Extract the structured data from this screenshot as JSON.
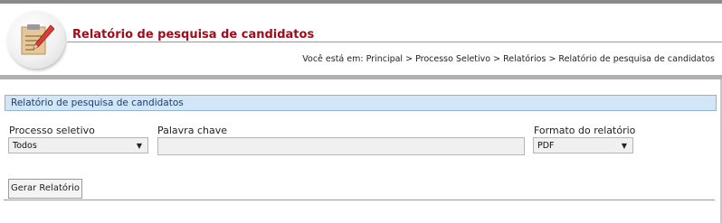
{
  "header": {
    "title": "Relatório de pesquisa de candidatos",
    "breadcrumb": "Você está em: Principal > Processo Seletivo > Relatórios > Relatório de pesquisa de candidatos"
  },
  "section": {
    "title": "Relatório de pesquisa de candidatos"
  },
  "form": {
    "processo": {
      "label": "Processo seletivo",
      "value": "Todos"
    },
    "palavra": {
      "label": "Palavra chave",
      "value": ""
    },
    "formato": {
      "label": "Formato do relatório",
      "value": "PDF"
    }
  },
  "actions": {
    "generate_label": "Gerar Relatório"
  },
  "colors": {
    "title_red": "#a30b1a",
    "section_bg": "#d3e6f7",
    "section_border": "#8fb5d8"
  },
  "icons": {
    "logo": "report-pencil-icon",
    "dropdown": "dropdown-arrow-icon"
  }
}
